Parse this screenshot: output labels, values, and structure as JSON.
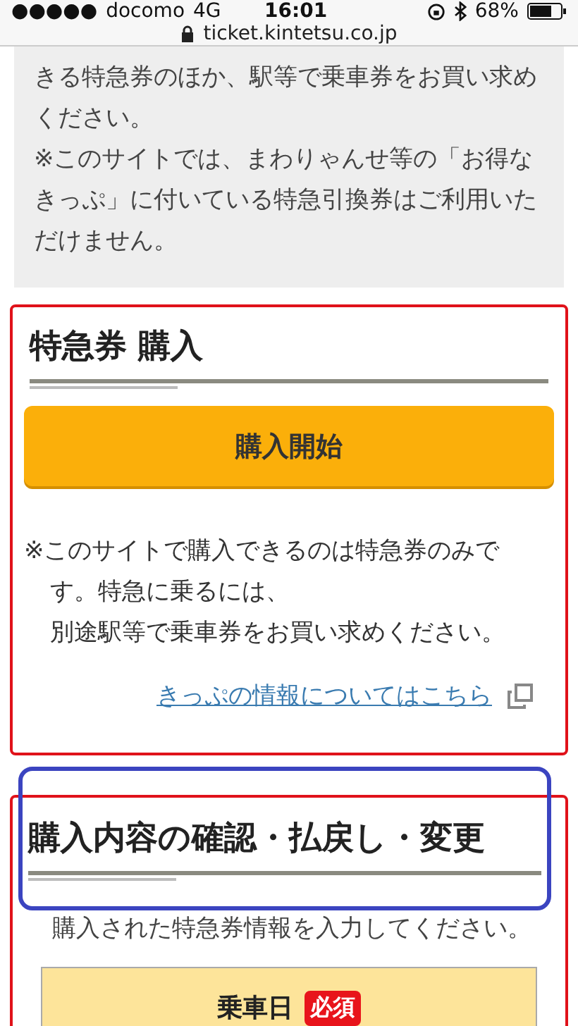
{
  "status_bar": {
    "signal": "●●●●●",
    "carrier": "docomo",
    "network": "4G",
    "time": "16:01",
    "battery": "68%"
  },
  "address_bar": {
    "url": "ticket.kintetsu.co.jp"
  },
  "notice": {
    "paragraphs": [
      "きる特急券のほか、駅等で乗車券をお買い求めください。",
      "※このサイトでは、まわりゃんせ等の「お得なきっぷ」に付いている特急引換券はご利用いただけません。"
    ]
  },
  "sections": [
    {
      "title": "特急券 購入",
      "highlighted": false,
      "button": "購入開始",
      "note_lines": [
        "※このサイトで購入できるのは特急券のみです。特急に乗るには、",
        "別途駅等で乗車券をお買い求めください。"
      ],
      "link": "きっぷの情報についてはこちら"
    },
    {
      "title": "購入内容の確認・払戻し・変更",
      "highlighted": true,
      "intro": "購入された特急券情報を入力してください。",
      "field": {
        "label": "乗車日",
        "badge": "必須"
      }
    }
  ]
}
